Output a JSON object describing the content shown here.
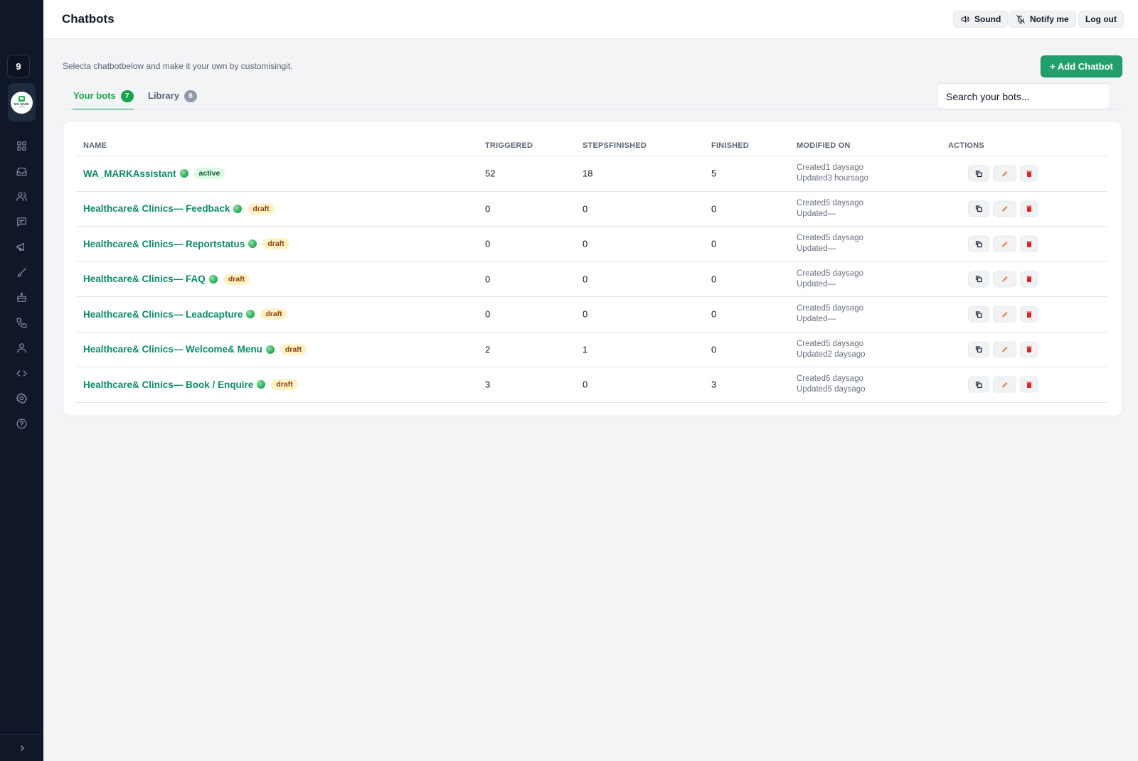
{
  "sidebar": {
    "badge": "9",
    "logo_text": "MS. MARK",
    "nav_icons": [
      "grid-icon",
      "inbox-icon",
      "users-icon",
      "chat-icon",
      "megaphone-icon",
      "brush-icon",
      "robot-icon",
      "phone-icon",
      "user-icon",
      "code-icon",
      "gear-icon",
      "help-icon"
    ],
    "bottom_icon": "chevron-right-icon"
  },
  "header": {
    "title": "Chatbots",
    "sound_label": "Sound",
    "notify_label": "Notify me",
    "logout_label": "Log out"
  },
  "main": {
    "subtitle": "Selecta chatbotbelow and make it your own by customisingit.",
    "add_label": "+ Add Chatbot",
    "search_placeholder": "Search your bots...",
    "tabs": [
      {
        "label": "Your bots",
        "count": "7"
      },
      {
        "label": "Library",
        "count": "6"
      }
    ]
  },
  "table": {
    "columns": [
      "NAME",
      "TRIGGERED",
      "STEPSFINISHED",
      "FINISHED",
      "MODIFIED ON",
      "ACTIONS"
    ],
    "rows": [
      {
        "name": "WA_MARKAssistant",
        "status": "active",
        "triggered": "52",
        "steps": "18",
        "finished": "5",
        "created": "Created1 daysago",
        "updated": "Updated3 hoursago"
      },
      {
        "name": "Healthcare& Clinics— Feedback",
        "status": "draft",
        "triggered": "0",
        "steps": "0",
        "finished": "0",
        "created": "Created5 daysago",
        "updated": "Updated—"
      },
      {
        "name": "Healthcare& Clinics— Reportstatus",
        "status": "draft",
        "triggered": "0",
        "steps": "0",
        "finished": "0",
        "created": "Created5 daysago",
        "updated": "Updated—"
      },
      {
        "name": "Healthcare& Clinics— FAQ",
        "status": "draft",
        "triggered": "0",
        "steps": "0",
        "finished": "0",
        "created": "Created5 daysago",
        "updated": "Updated—"
      },
      {
        "name": "Healthcare& Clinics— Leadcapture",
        "status": "draft",
        "triggered": "0",
        "steps": "0",
        "finished": "0",
        "created": "Created5 daysago",
        "updated": "Updated—"
      },
      {
        "name": "Healthcare& Clinics— Welcome& Menu",
        "status": "draft",
        "triggered": "2",
        "steps": "1",
        "finished": "0",
        "created": "Created5 daysago",
        "updated": "Updated2 daysago"
      },
      {
        "name": "Healthcare& Clinics— Book / Enquire",
        "status": "draft",
        "triggered": "3",
        "steps": "0",
        "finished": "3",
        "created": "Created6 daysago",
        "updated": "Updated5 daysago"
      }
    ]
  },
  "colors": {
    "accent": "#16a34a",
    "bot_name": "#0f8a6a",
    "sidebar_bg": "#0f1729",
    "edit_icon": "#ea7a3c",
    "delete_icon": "#dc2626"
  }
}
